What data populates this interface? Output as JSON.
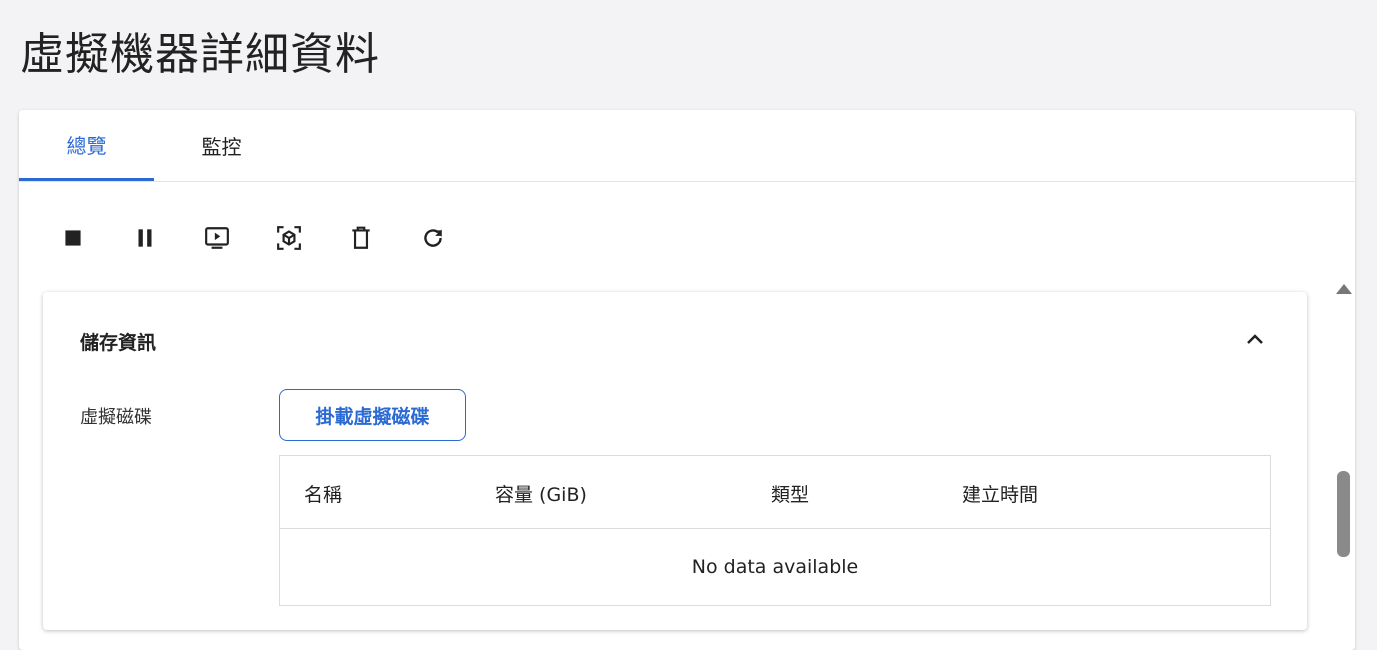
{
  "page": {
    "title": "虛擬機器詳細資料"
  },
  "tabs": [
    {
      "label": "總覽",
      "active": true
    },
    {
      "label": "監控",
      "active": false
    }
  ],
  "toolbar": {
    "icons": [
      "stop-icon",
      "pause-icon",
      "console-icon",
      "snapshot-icon",
      "delete-icon",
      "refresh-icon"
    ]
  },
  "storage": {
    "title": "儲存資訊",
    "field_label": "虛擬磁碟",
    "attach_label": "掛載虛擬磁碟",
    "columns": [
      "名稱",
      "容量 (GiB)",
      "類型",
      "建立時間"
    ],
    "empty_text": "No data available"
  },
  "colors": {
    "accent": "#2b6ad3",
    "background": "#f3f3f5"
  }
}
